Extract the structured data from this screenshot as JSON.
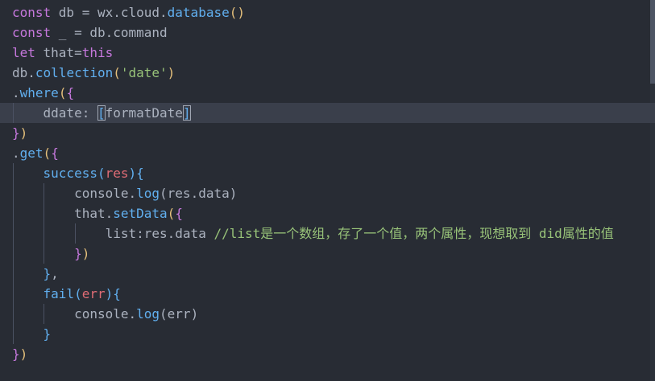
{
  "editor": {
    "lines": [
      {
        "segments": [
          {
            "t": "const ",
            "c": "kw"
          },
          {
            "t": "db = wx.cloud.",
            "c": "pl"
          },
          {
            "t": "database",
            "c": "fn"
          },
          {
            "t": "()",
            "c": "br1"
          }
        ]
      },
      {
        "segments": [
          {
            "t": "const ",
            "c": "kw"
          },
          {
            "t": "_ = db.command",
            "c": "pl"
          }
        ]
      },
      {
        "segments": [
          {
            "t": "let ",
            "c": "kw"
          },
          {
            "t": "that=",
            "c": "pl"
          },
          {
            "t": "this",
            "c": "kw"
          }
        ]
      },
      {
        "segments": [
          {
            "t": "db.",
            "c": "pl"
          },
          {
            "t": "collection",
            "c": "fn"
          },
          {
            "t": "(",
            "c": "br1"
          },
          {
            "t": "'date'",
            "c": "str"
          },
          {
            "t": ")",
            "c": "br1"
          }
        ]
      },
      {
        "segments": [
          {
            "t": ".",
            "c": "pl"
          },
          {
            "t": "where",
            "c": "fn"
          },
          {
            "t": "(",
            "c": "br1"
          },
          {
            "t": "{",
            "c": "br2"
          }
        ]
      },
      {
        "segments": [
          {
            "t": "    ddate: ",
            "c": "pl"
          },
          {
            "t": "[",
            "c": "br3",
            "box": true
          },
          {
            "t": "formatDate",
            "c": "pl"
          },
          {
            "t": "]",
            "c": "br3",
            "box": true
          }
        ]
      },
      {
        "segments": [
          {
            "t": "}",
            "c": "br2"
          },
          {
            "t": ")",
            "c": "br1"
          }
        ]
      },
      {
        "segments": [
          {
            "t": ".",
            "c": "pl"
          },
          {
            "t": "get",
            "c": "fn"
          },
          {
            "t": "(",
            "c": "br1"
          },
          {
            "t": "{",
            "c": "br2"
          }
        ]
      },
      {
        "segments": [
          {
            "t": "    ",
            "c": "pl"
          },
          {
            "t": "success",
            "c": "fn"
          },
          {
            "t": "(",
            "c": "br3"
          },
          {
            "t": "res",
            "c": "var"
          },
          {
            "t": ")",
            "c": "br3"
          },
          {
            "t": "{",
            "c": "br3"
          }
        ]
      },
      {
        "segments": [
          {
            "t": "        console.",
            "c": "pl"
          },
          {
            "t": "log",
            "c": "fn"
          },
          {
            "t": "(res.data)",
            "c": "pl"
          }
        ]
      },
      {
        "segments": [
          {
            "t": "        that.",
            "c": "pl"
          },
          {
            "t": "setData",
            "c": "fn"
          },
          {
            "t": "(",
            "c": "br1"
          },
          {
            "t": "{",
            "c": "br2"
          }
        ]
      },
      {
        "segments": [
          {
            "t": "            list:res.data ",
            "c": "pl"
          },
          {
            "t": "//list是一个数组，存了一个值，两个属性，现想取到 did属性的值",
            "c": "cmt"
          }
        ]
      },
      {
        "segments": [
          {
            "t": "        ",
            "c": "pl"
          },
          {
            "t": "}",
            "c": "br2"
          },
          {
            "t": ")",
            "c": "br1"
          }
        ]
      },
      {
        "segments": [
          {
            "t": "    ",
            "c": "pl"
          },
          {
            "t": "}",
            "c": "br3"
          },
          {
            "t": ",",
            "c": "pl"
          }
        ]
      },
      {
        "segments": [
          {
            "t": "    ",
            "c": "pl"
          },
          {
            "t": "fail",
            "c": "fn"
          },
          {
            "t": "(",
            "c": "br3"
          },
          {
            "t": "err",
            "c": "var"
          },
          {
            "t": ")",
            "c": "br3"
          },
          {
            "t": "{",
            "c": "br3"
          }
        ]
      },
      {
        "segments": [
          {
            "t": "        console.",
            "c": "pl"
          },
          {
            "t": "log",
            "c": "fn"
          },
          {
            "t": "(err)",
            "c": "pl"
          }
        ]
      },
      {
        "segments": [
          {
            "t": "    ",
            "c": "pl"
          },
          {
            "t": "}",
            "c": "br3"
          }
        ]
      },
      {
        "segments": [
          {
            "t": "}",
            "c": "br2"
          },
          {
            "t": ")",
            "c": "br1"
          }
        ]
      }
    ],
    "current_line": 5,
    "colors": {
      "background": "#282c34",
      "current_line": "#3a3f4b",
      "keyword": "#c678dd",
      "function": "#61afef",
      "string": "#98c379",
      "variable": "#e06c75",
      "plain": "#abb2bf",
      "comment": "#98c379"
    }
  }
}
